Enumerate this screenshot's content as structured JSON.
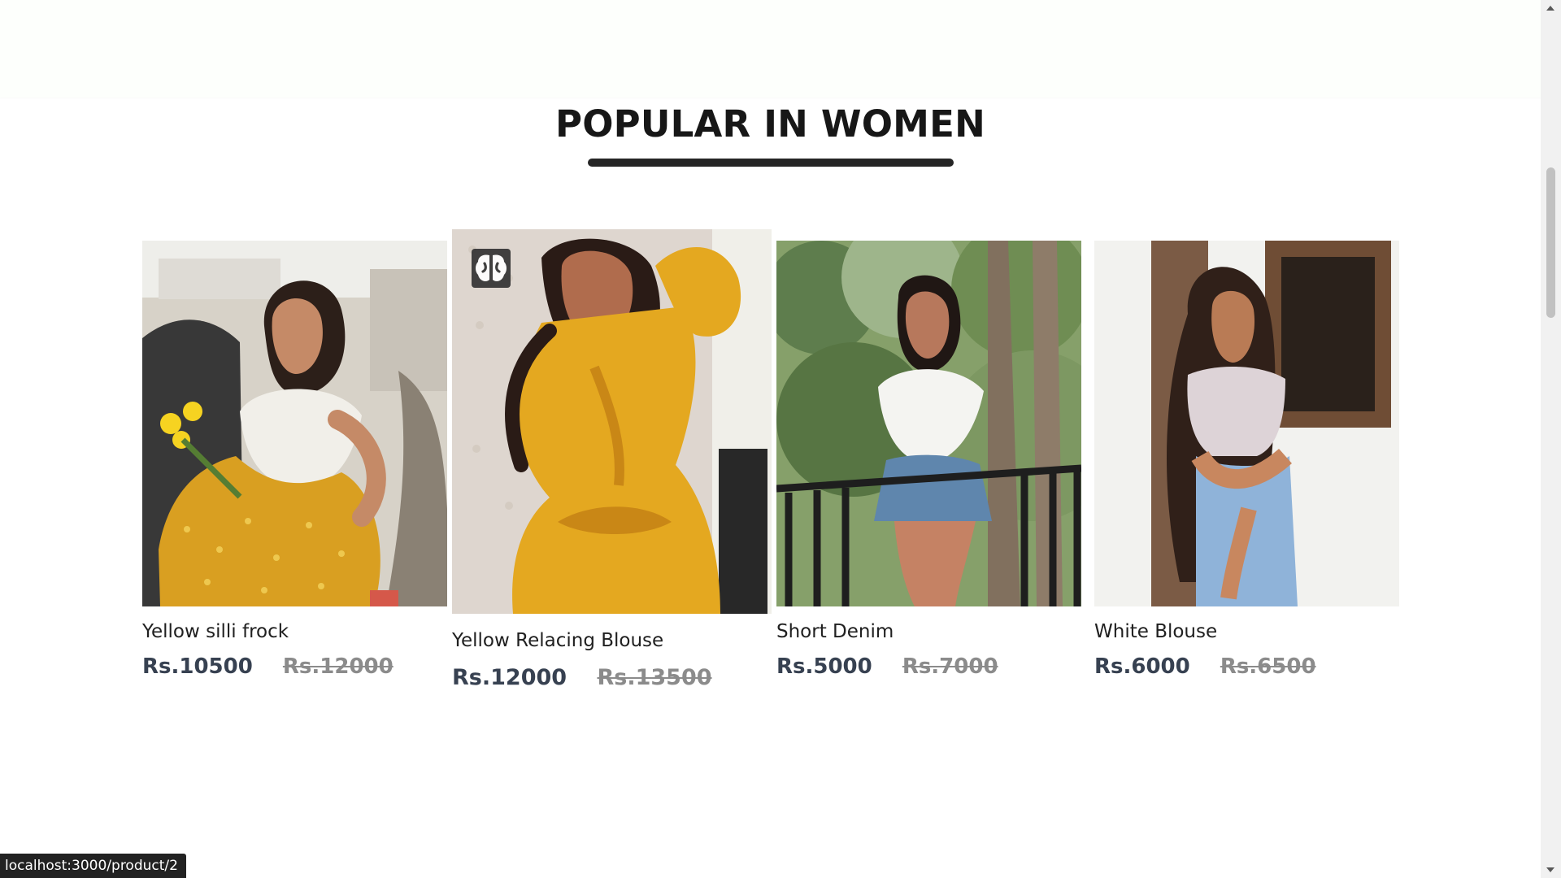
{
  "section": {
    "title": "POPULAR IN WOMEN"
  },
  "products": [
    {
      "name": "Yellow silli frock",
      "new_price": "Rs.10500",
      "old_price": "Rs.12000"
    },
    {
      "name": "Yellow Relacing Blouse",
      "new_price": "Rs.12000",
      "old_price": "Rs.13500",
      "badge_icon": "brain-icon"
    },
    {
      "name": "Short Denim",
      "new_price": "Rs.5000",
      "old_price": "Rs.7000"
    },
    {
      "name": "White Blouse",
      "new_price": "Rs.6000",
      "old_price": "Rs.6500"
    }
  ],
  "status_bar": {
    "url": "localhost:3000/product/2"
  },
  "colors": {
    "title": "#171717",
    "underline": "#252525",
    "new_price": "#374151",
    "old_price": "#8b8b8b",
    "status_background": "#222222"
  }
}
